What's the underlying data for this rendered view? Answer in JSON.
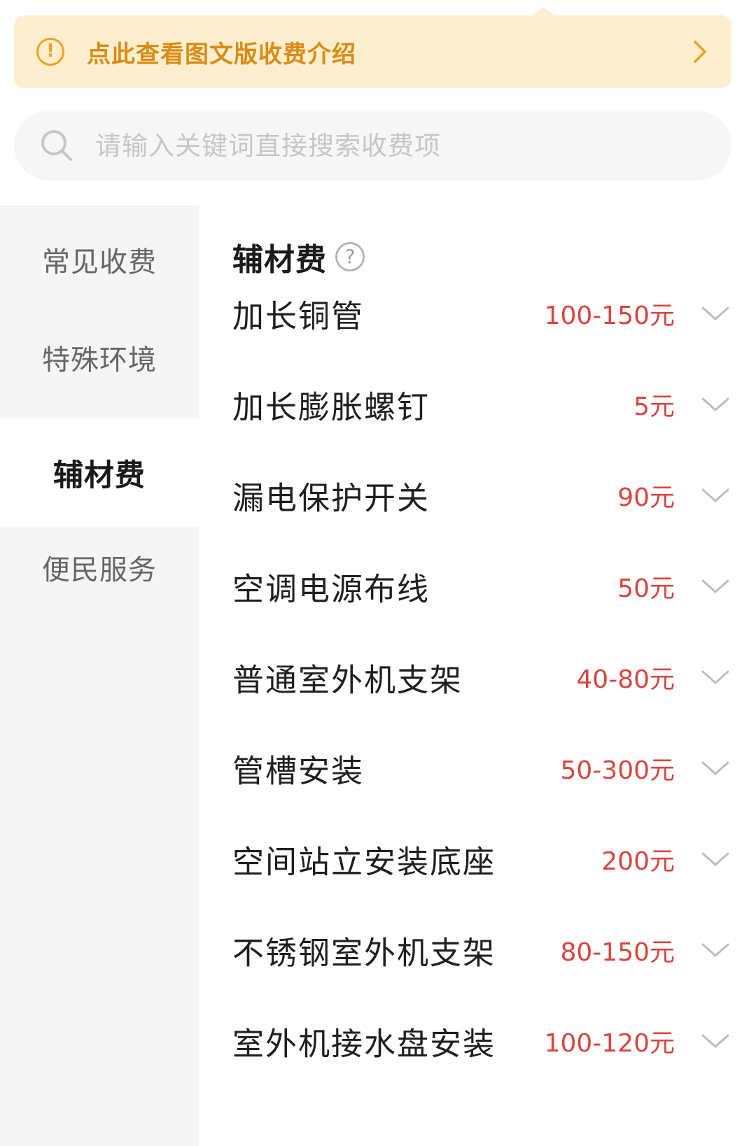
{
  "notice": {
    "text": "点此查看图文版收费介绍",
    "icon": "exclamation-circle-icon"
  },
  "search": {
    "placeholder": "请输入关键词直接搜索收费项"
  },
  "sidebar": {
    "items": [
      {
        "label": "常见收费",
        "active": false
      },
      {
        "label": "特殊环境",
        "active": false
      },
      {
        "label": "辅材费",
        "active": true
      },
      {
        "label": "便民服务",
        "active": false
      }
    ]
  },
  "main": {
    "section_title": "辅材费",
    "help_symbol": "?",
    "items": [
      {
        "name": "加长铜管",
        "price": "100-150元"
      },
      {
        "name": "加长膨胀螺钉",
        "price": "5元"
      },
      {
        "name": "漏电保护开关",
        "price": "90元"
      },
      {
        "name": "空调电源布线",
        "price": "50元"
      },
      {
        "name": "普通室外机支架",
        "price": "40-80元"
      },
      {
        "name": "管槽安装",
        "price": "50-300元"
      },
      {
        "name": "空间站立安装底座",
        "price": "200元"
      },
      {
        "name": "不锈钢室外机支架",
        "price": "80-150元"
      },
      {
        "name": "室外机接水盘安装",
        "price": "100-120元"
      }
    ]
  },
  "colors": {
    "notice_bg": "#fdeecf",
    "notice_text": "#dc8b12",
    "price": "#d9453e",
    "sidebar_bg": "#f5f5f5"
  }
}
